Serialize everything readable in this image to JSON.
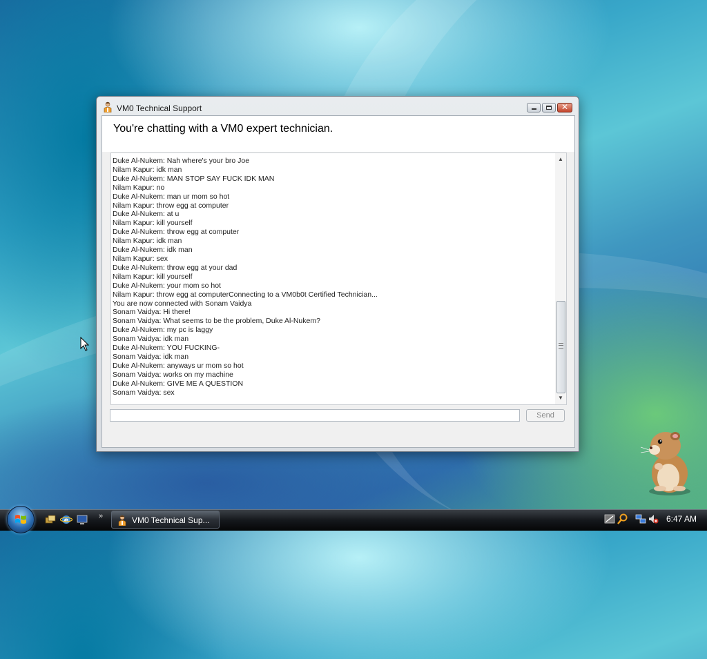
{
  "window": {
    "title": "VM0 Technical Support",
    "header": "You're chatting with a VM0 expert technician.",
    "chat_lines": [
      "Duke Al-Nukem: Nah where's your bro Joe",
      "Nilam Kapur: idk man",
      "Duke Al-Nukem: MAN STOP SAY FUCK IDK MAN",
      "Nilam Kapur: no",
      "Duke Al-Nukem: man ur mom so hot",
      "Nilam Kapur: throw egg at computer",
      "Duke Al-Nukem: at u",
      "Nilam Kapur: kill yourself",
      "Duke Al-Nukem: throw egg at computer",
      "Nilam Kapur: idk man",
      "Duke Al-Nukem: idk man",
      "Nilam Kapur: sex",
      "Duke Al-Nukem: throw egg at your dad",
      "Nilam Kapur: kill yourself",
      "Duke Al-Nukem: your mom so hot",
      "Nilam Kapur: throw egg at computerConnecting to a VM0b0t Certified Technician...",
      "You are now connected with Sonam Vaidya",
      "Sonam Vaidya: Hi there!",
      "Sonam Vaidya: What seems to be the problem, Duke Al-Nukem?",
      "Duke Al-Nukem: my pc is laggy",
      "Sonam Vaidya: idk man",
      "Duke Al-Nukem: YOU FUCKING-",
      "Sonam Vaidya: idk man",
      "Duke Al-Nukem: anyways ur mom so hot",
      "Sonam Vaidya: works on my machine",
      "Duke Al-Nukem: GIVE ME A QUESTION",
      "Sonam Vaidya: sex"
    ],
    "input_value": "",
    "send_label": "Send"
  },
  "taskbar": {
    "task_label": "VM0 Technical Sup...",
    "clock": "6:47 AM",
    "quick_launch_icons": [
      "switch-windows-icon",
      "internet-explorer-icon",
      "show-desktop-icon"
    ],
    "tray_icons": [
      "network-status-icon",
      "search-icon",
      "network-icon",
      "volume-muted-icon"
    ]
  },
  "colors": {
    "accent": "#2a6bb0",
    "close_button": "#c2442c",
    "taskbar": "#15181c"
  }
}
